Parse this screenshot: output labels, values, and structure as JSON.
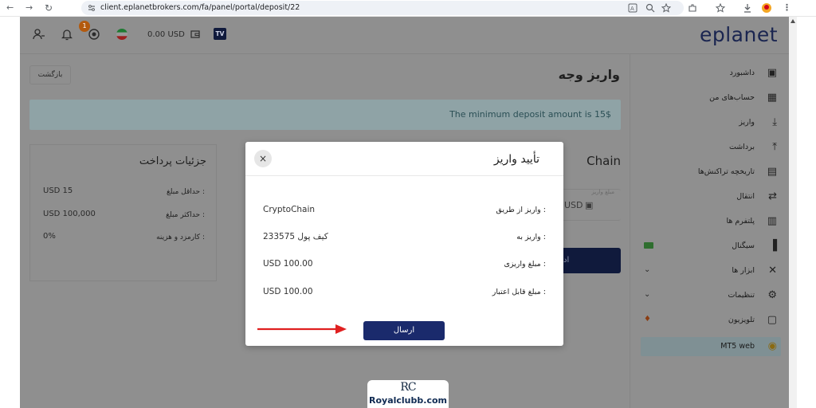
{
  "browser": {
    "url": "client.eplanetbrokers.com/fa/panel/portal/deposit/22",
    "back_icon": "←",
    "forward_icon": "→",
    "reload_icon": "↻"
  },
  "header": {
    "balance": "0.00 USD",
    "notification_count": "1",
    "brand": "eplanet",
    "tv_badge": "TV"
  },
  "sidebar": {
    "items": [
      {
        "label": "داشبورد",
        "icon": "dashboard-icon",
        "glyph": "▣"
      },
      {
        "label": "حساب‌های من",
        "icon": "grid-icon",
        "glyph": "▦"
      },
      {
        "label": "واریز",
        "icon": "download-icon",
        "glyph": "⤓"
      },
      {
        "label": "برداشت",
        "icon": "upload-icon",
        "glyph": "⤒"
      },
      {
        "label": "تاریخچه تراکنش‌ها",
        "icon": "history-icon",
        "glyph": "▤"
      },
      {
        "label": "انتقال",
        "icon": "transfer-icon",
        "glyph": "⇄"
      },
      {
        "label": "پلتفرم ها",
        "icon": "platform-icon",
        "glyph": "▥"
      },
      {
        "label": "سیگنال",
        "icon": "signal-icon",
        "glyph": "▐"
      },
      {
        "label": "ابزار ها",
        "icon": "tools-icon",
        "glyph": "✕"
      },
      {
        "label": "تنظیمات",
        "icon": "settings-icon",
        "glyph": "⚙"
      },
      {
        "label": "تلویزیون",
        "icon": "tv-icon",
        "glyph": "▢"
      },
      {
        "label": "MT5 web",
        "icon": "mt5-icon",
        "glyph": "◉"
      }
    ],
    "chevron": "⌄",
    "fire": "♦"
  },
  "main": {
    "page_title": "واریز وجه",
    "back_button": "بازگشت",
    "notice": "The minimum deposit amount is 15$",
    "payment_details": {
      "title": "جزئیات پرداخت",
      "rows": [
        {
          "label": "حداقل مبلغ :",
          "value": "USD 15"
        },
        {
          "label": "حداکثر مبلغ :",
          "value": "USD 100,000"
        },
        {
          "label": "کارمزد و هزینه :",
          "value": "0%"
        }
      ]
    },
    "method_title_partial": "Chain",
    "amount_label_partial": "مبلغ واریز",
    "currency": "USD",
    "submit_partial": "اد"
  },
  "modal": {
    "title": "تأیید واریز",
    "close": "×",
    "rows": [
      {
        "label": "واریز از طریق :",
        "value": "CryptoChain"
      },
      {
        "label": "واریز به :",
        "value": "کیف پول 233575"
      },
      {
        "label": "مبلغ واریزی :",
        "value": "USD 100.00"
      },
      {
        "label": "مبلغ قابل اعتبار :",
        "value": "USD 100.00"
      }
    ],
    "submit": "ارسال"
  },
  "watermark": {
    "logo": "RC",
    "text": "Royalclubb.com"
  },
  "colors": {
    "overlay": "#8f8f8f",
    "primary": "#1a2a6c",
    "arrow": "#e02020"
  }
}
